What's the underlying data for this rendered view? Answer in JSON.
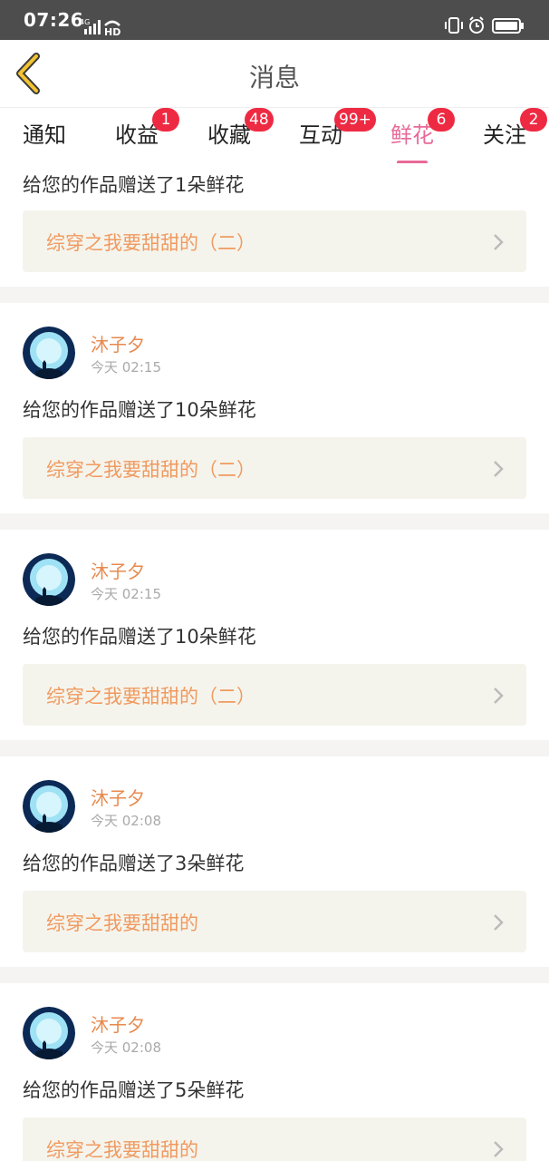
{
  "status_bar": {
    "time": "07:26",
    "network_label": "4G",
    "hd_label": "HD"
  },
  "nav": {
    "title": "消息"
  },
  "tabs": [
    {
      "label": "通知",
      "badge": ""
    },
    {
      "label": "收益",
      "badge": "1"
    },
    {
      "label": "收藏",
      "badge": "48"
    },
    {
      "label": "互动",
      "badge": "99+"
    },
    {
      "label": "鲜花",
      "badge": "6",
      "active": true
    },
    {
      "label": "关注",
      "badge": "2"
    }
  ],
  "colors": {
    "accent": "#e86a98",
    "badge": "#ee2a42",
    "username": "#e88a4e",
    "link_text": "#f09a60"
  },
  "messages": [
    {
      "text": "给您的作品赠送了1朵鲜花",
      "work": "综穿之我要甜甜的（二）"
    },
    {
      "user": "沐子夕",
      "time": "今天 02:15",
      "text": "给您的作品赠送了10朵鲜花",
      "work": "综穿之我要甜甜的（二）"
    },
    {
      "user": "沐子夕",
      "time": "今天 02:15",
      "text": "给您的作品赠送了10朵鲜花",
      "work": "综穿之我要甜甜的（二）"
    },
    {
      "user": "沐子夕",
      "time": "今天 02:08",
      "text": "给您的作品赠送了3朵鲜花",
      "work": "综穿之我要甜甜的"
    },
    {
      "user": "沐子夕",
      "time": "今天 02:08",
      "text": "给您的作品赠送了5朵鲜花",
      "work": "综穿之我要甜甜的"
    }
  ]
}
